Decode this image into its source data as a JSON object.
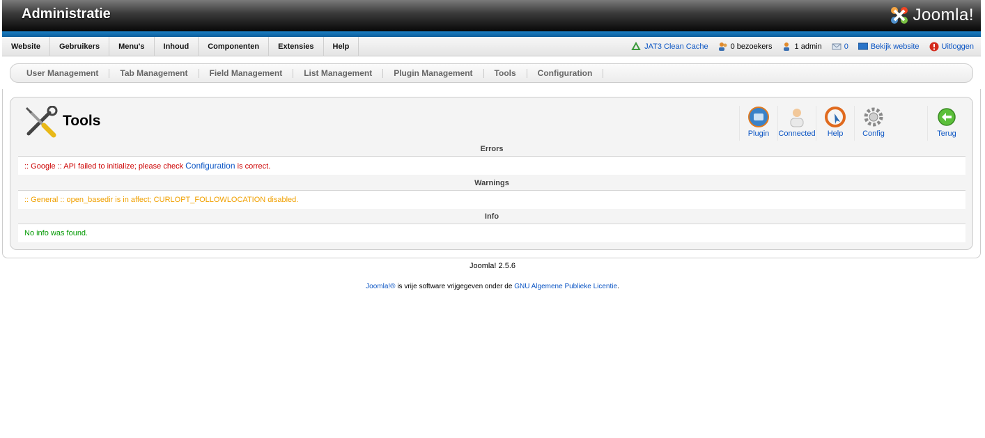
{
  "header": {
    "title": "Administratie",
    "logo_text": "Joomla!"
  },
  "menu": {
    "items": [
      "Website",
      "Gebruikers",
      "Menu's",
      "Inhoud",
      "Componenten",
      "Extensies",
      "Help"
    ]
  },
  "status": {
    "cache": "JAT3 Clean Cache",
    "visitors": "0 bezoekers",
    "admins": "1 admin",
    "messages": "0",
    "view_site": "Bekijk website",
    "logout": "Uitloggen"
  },
  "submenu": {
    "items": [
      "User Management",
      "Tab Management",
      "Field Management",
      "List Management",
      "Plugin Management",
      "Tools",
      "Configuration"
    ]
  },
  "page": {
    "title": "Tools"
  },
  "toolbar": {
    "plugin": "Plugin",
    "connected": "Connected",
    "help": "Help",
    "config": "Config",
    "back": "Terug"
  },
  "sections": {
    "errors": {
      "heading": "Errors",
      "prefix": ":: Google :: API failed to initialize; please check ",
      "link": "Configuration",
      "suffix": " is correct."
    },
    "warnings": {
      "heading": "Warnings",
      "text": ":: General :: open_basedir is in affect; CURLOPT_FOLLOWLOCATION disabled."
    },
    "info": {
      "heading": "Info",
      "text": "No info was found."
    }
  },
  "footer": {
    "version": "Joomla! 2.5.6",
    "joomla_link": "Joomla!®",
    "middle": " is vrije software vrijgegeven onder de ",
    "license_link": "GNU Algemene Publieke Licentie",
    "end": "."
  },
  "colors": {
    "link": "#0b55c4",
    "error": "#cc0000",
    "warning": "#f0a000",
    "info": "#009900",
    "header_strip": "#1a7fc4"
  }
}
